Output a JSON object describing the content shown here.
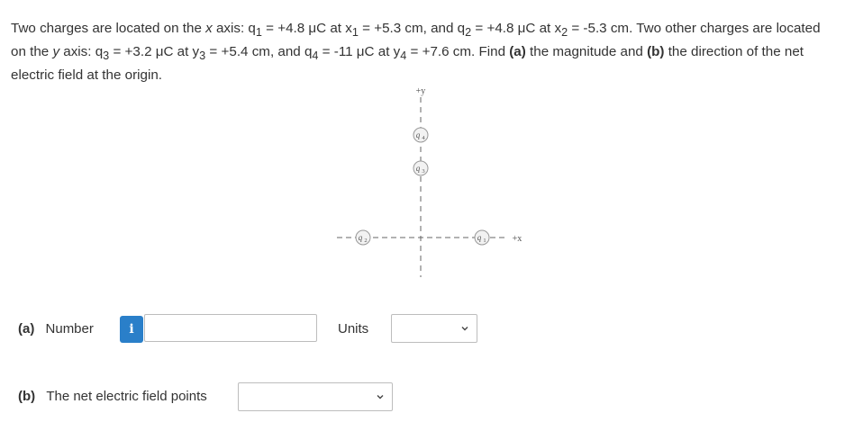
{
  "problem": {
    "line1_a": "Two charges are located on the ",
    "line1_x": "x",
    "line1_b": " axis: q",
    "q1sub": "1",
    "line1_c": " = +4.8 μC at x",
    "x1sub": "1",
    "line1_d": " = +5.3 cm, and q",
    "q2sub": "2",
    "line1_e": " = +4.8 μC at x",
    "x2sub": "2",
    "line1_f": " = -5.3 cm. Two other charges are located on the ",
    "line2_y": "y",
    "line2_a": " axis: q",
    "q3sub": "3",
    "line2_b": " = +3.2 μC at y",
    "y3sub": "3",
    "line2_c": " = +5.4 cm, and q",
    "q4sub": "4",
    "line2_d": " = -11 μC at y",
    "y4sub": "4",
    "line2_e": " = +7.6 cm. Find ",
    "part_a_bold": "(a)",
    "line2_f": " the magnitude and ",
    "part_b_bold": "(b)",
    "line2_g": " the direction of the net electric field at the origin."
  },
  "diagram": {
    "axis_plus_y": "+y",
    "axis_plus_x": "+x",
    "charges": [
      {
        "label": "q",
        "sub": "4"
      },
      {
        "label": "q",
        "sub": "3"
      },
      {
        "label": "q",
        "sub": "2"
      },
      {
        "label": "q",
        "sub": "1"
      }
    ]
  },
  "part_a": {
    "label": "(a)",
    "field_label": "Number",
    "info_icon": "i",
    "number_value": "",
    "units_label": "Units",
    "units_selected": ""
  },
  "part_b": {
    "label": "(b)",
    "field_label": "The net electric field points",
    "direction_selected": ""
  },
  "colors": {
    "info_button": "#2a7fc9",
    "charge_fill": "#f2f2f2",
    "charge_stroke": "#999999"
  }
}
